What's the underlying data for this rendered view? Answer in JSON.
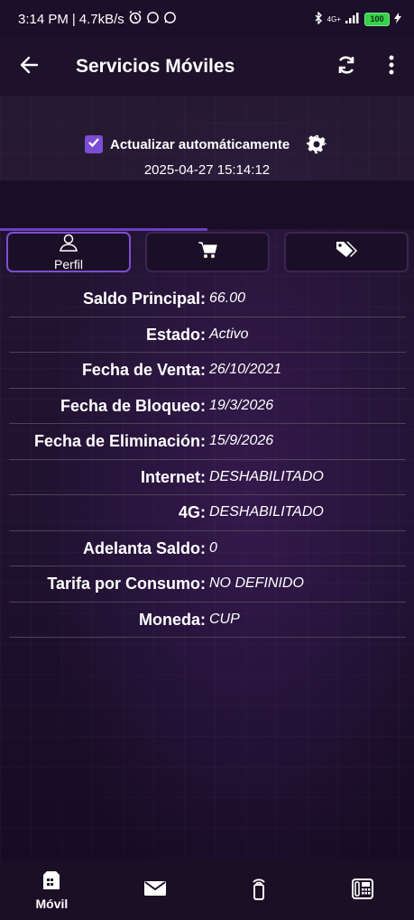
{
  "status_bar": {
    "time": "3:14 PM",
    "speed": "4.7kB/s",
    "network": "4G+",
    "battery": "100"
  },
  "app_bar": {
    "title": "Servicios Móviles",
    "icons": [
      "back-arrow-icon",
      "refresh-icon",
      "more-vert-icon"
    ]
  },
  "auto_update": {
    "label": "Actualizar automáticamente",
    "checked": true,
    "timestamp": "2025-04-27 15:14:12"
  },
  "tabs": [
    {
      "label": "Perfil",
      "icon": "user-icon",
      "active": true
    },
    {
      "label": "",
      "icon": "cart-icon",
      "active": false
    },
    {
      "label": "",
      "icon": "tags-icon",
      "active": false
    }
  ],
  "profile": {
    "rows": [
      {
        "label": "Saldo Principal:",
        "value": "66.00"
      },
      {
        "label": "Estado:",
        "value": "Activo"
      },
      {
        "label": "Fecha de Venta:",
        "value": "26/10/2021"
      },
      {
        "label": "Fecha de Bloqueo:",
        "value": "19/3/2026"
      },
      {
        "label": "Fecha de Eliminación:",
        "value": "15/9/2026"
      },
      {
        "label": "Internet:",
        "value": "DESHABILITADO"
      },
      {
        "label": "4G:",
        "value": "DESHABILITADO"
      },
      {
        "label": "Adelanta Saldo:",
        "value": "0"
      },
      {
        "label": "Tarifa por Consumo:",
        "value": "NO DEFINIDO"
      },
      {
        "label": "Moneda:",
        "value": "CUP"
      }
    ]
  },
  "bottom_nav": [
    {
      "label": "Móvil",
      "icon": "sim-card-icon",
      "active": true
    },
    {
      "label": "",
      "icon": "mail-icon",
      "active": false
    },
    {
      "label": "",
      "icon": "phone-signal-icon",
      "active": false
    },
    {
      "label": "",
      "icon": "landline-icon",
      "active": false
    }
  ],
  "colors": {
    "accent": "#7b4cd4",
    "background": "#1e1129",
    "divider": "#4d4256"
  }
}
